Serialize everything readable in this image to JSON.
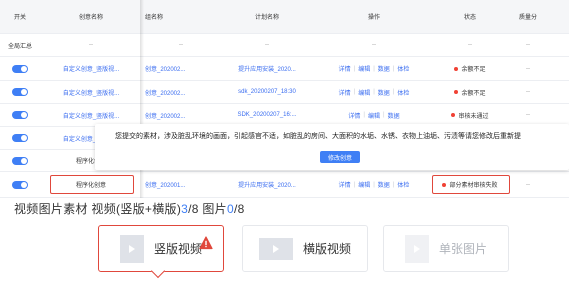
{
  "table": {
    "headers": {
      "switch": "开关",
      "creative": "创意名称",
      "group": "组名称",
      "plan": "计划名称",
      "ops": "操作",
      "status": "状态",
      "quality": "质量分"
    },
    "total_row": {
      "label": "全局汇总",
      "creative": "--",
      "group": "--",
      "plan": "--",
      "ops": "--",
      "status": "--",
      "quality": "--"
    },
    "rows": [
      {
        "creative": "自定义创意_竖版视...",
        "group": "创意_202002...",
        "plan": "提升应用安装_2020...",
        "ops": [
          "详情",
          "编辑",
          "数据",
          "体检"
        ],
        "status": "余额不足",
        "quality": "--"
      },
      {
        "creative": "自定义创意_竖版视...",
        "group": "创意_202002...",
        "plan": "sdk_20200207_18:30",
        "ops": [
          "详情",
          "编辑",
          "数据",
          "体检"
        ],
        "status": "余额不足",
        "quality": "--"
      },
      {
        "creative": "自定义创意_竖版视...",
        "group": "创意_202002...",
        "plan": "SDK_20200207_16:...",
        "ops": [
          "详情",
          "编辑",
          "数据"
        ],
        "status": "审核未通过",
        "quality": "--"
      },
      {
        "creative": "自定义创意_竖版视...",
        "group": "",
        "plan": "",
        "ops": [],
        "status": "",
        "quality": ""
      },
      {
        "creative": "程序化创意",
        "group": "",
        "plan": "",
        "ops": [],
        "status": "",
        "quality": ""
      },
      {
        "creative": "程序化创意",
        "group": "创意_202001...",
        "plan": "提升应用安装_2020...",
        "ops": [
          "详情",
          "编辑",
          "数据",
          "体检"
        ],
        "status": "部分素材审核失败",
        "quality": "--"
      }
    ]
  },
  "tooltip": {
    "text": "您提交的素材，涉及脏乱环境的画面，引起感官不适，如脏乱的房间、大面积的水垢、水锈、衣物上油垢、污渍等请您修改后重新提",
    "button": "修改创意"
  },
  "material": {
    "label_prefix": "视频图片素材  视频(竖版+横版)",
    "video_count": "3",
    "video_total": "/8",
    "image_label": "  图片",
    "image_count": "0",
    "image_total": "/8"
  },
  "cards": [
    {
      "label": "竖版视频",
      "icon": "play-icon",
      "active": true,
      "warning": true
    },
    {
      "label": "横版视频",
      "icon": "play-icon",
      "active": false,
      "warning": false
    },
    {
      "label": "单张图片",
      "icon": "image-icon",
      "active": false,
      "warning": false,
      "disabled": true
    }
  ],
  "colors": {
    "accent": "#3f7ff5",
    "error": "#e0483c",
    "status_dot": "#f04134",
    "link": "#3a6df0"
  }
}
